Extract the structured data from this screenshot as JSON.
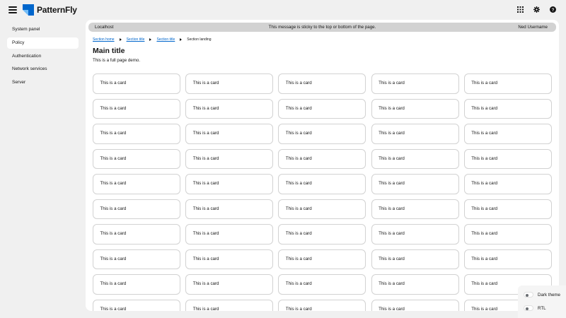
{
  "header": {
    "brand": "PatternFly",
    "brand_color": "#0066cc",
    "icons": [
      "menu-icon",
      "grid-icon",
      "gear-icon",
      "help-icon"
    ]
  },
  "sidebar": {
    "items": [
      {
        "label": "System panel",
        "active": false
      },
      {
        "label": "Policy",
        "active": true
      },
      {
        "label": "Authentication",
        "active": false
      },
      {
        "label": "Network services",
        "active": false
      },
      {
        "label": "Server",
        "active": false
      }
    ]
  },
  "banner": {
    "left": "Localhost",
    "center": "This message is sticky to the top or bottom of the page.",
    "right": "Ned Username"
  },
  "breadcrumb": {
    "items": [
      "Section home",
      "Section title",
      "Section title"
    ],
    "current": "Section landing"
  },
  "page": {
    "title": "Main title",
    "subtitle": "This is a full page demo."
  },
  "cards": {
    "label": "This is a card",
    "columns": 5,
    "rows": 10
  },
  "theme_switcher": {
    "dark_label": "Dark theme",
    "rtl_label": "RTL"
  }
}
